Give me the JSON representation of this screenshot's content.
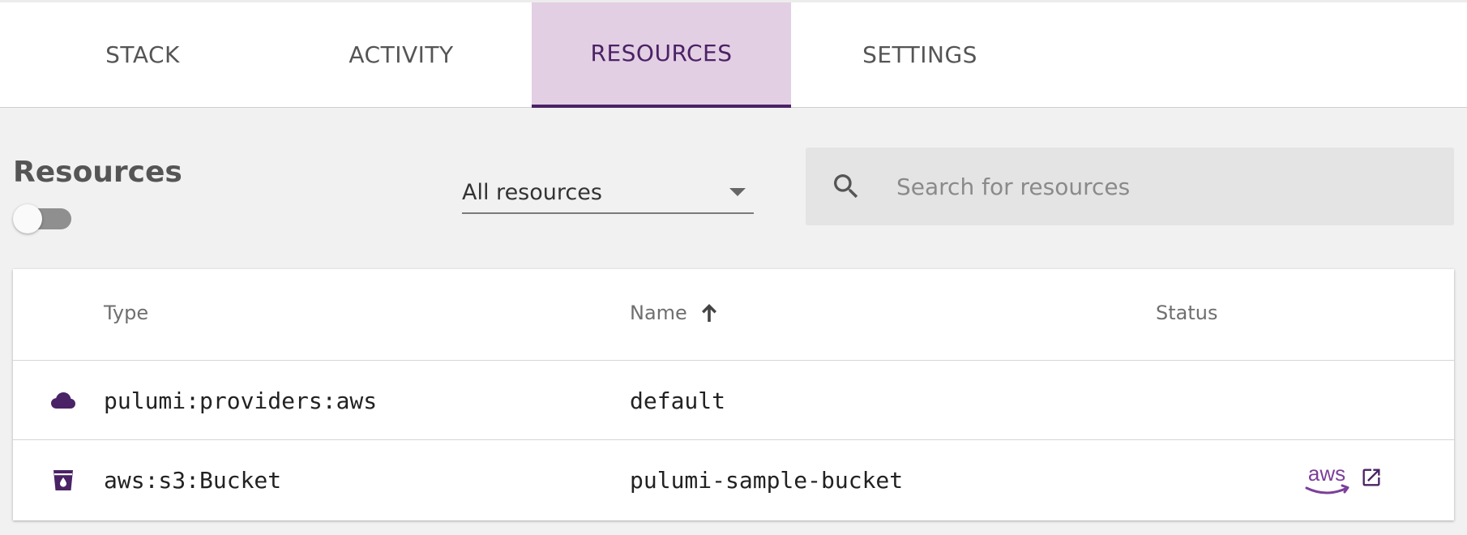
{
  "tabs": [
    {
      "label": "STACK",
      "active": false
    },
    {
      "label": "ACTIVITY",
      "active": false
    },
    {
      "label": "RESOURCES",
      "active": true
    },
    {
      "label": "SETTINGS",
      "active": false
    }
  ],
  "header": {
    "title": "Resources",
    "filter": {
      "selected": "All resources"
    },
    "search": {
      "placeholder": "Search for resources",
      "value": ""
    }
  },
  "table": {
    "columns": [
      "Type",
      "Name",
      "Status"
    ],
    "sort_column": "Name",
    "sort_direction": "ascending",
    "rows": [
      {
        "icon": "cloud-icon",
        "type": "pulumi:providers:aws",
        "name": "default",
        "status": ""
      },
      {
        "icon": "bucket-icon",
        "type": "aws:s3:Bucket",
        "name": "pulumi-sample-bucket",
        "status": ""
      }
    ]
  },
  "colors": {
    "accent": "#4a2266",
    "active_tab_bg": "#e3cfe3",
    "aws_logo": "#7b3f99"
  }
}
